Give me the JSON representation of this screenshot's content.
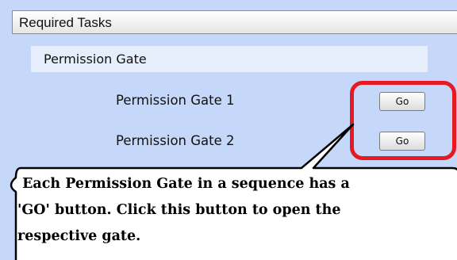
{
  "header": {
    "title": "Required Tasks"
  },
  "section": {
    "title": "Permission Gate"
  },
  "tasks": [
    {
      "label": "Permission Gate 1",
      "button_label": "Go"
    },
    {
      "label": "Permission Gate  2",
      "button_label": "Go"
    }
  ],
  "callout": {
    "lines": [
      " Each Permission Gate in a sequence has a",
      "'GO' button. Click this button to open the",
      "respective gate."
    ]
  },
  "colors": {
    "page_background": "#c5d8f9",
    "section_background": "#e6eefc",
    "highlight": "#e61a23"
  }
}
